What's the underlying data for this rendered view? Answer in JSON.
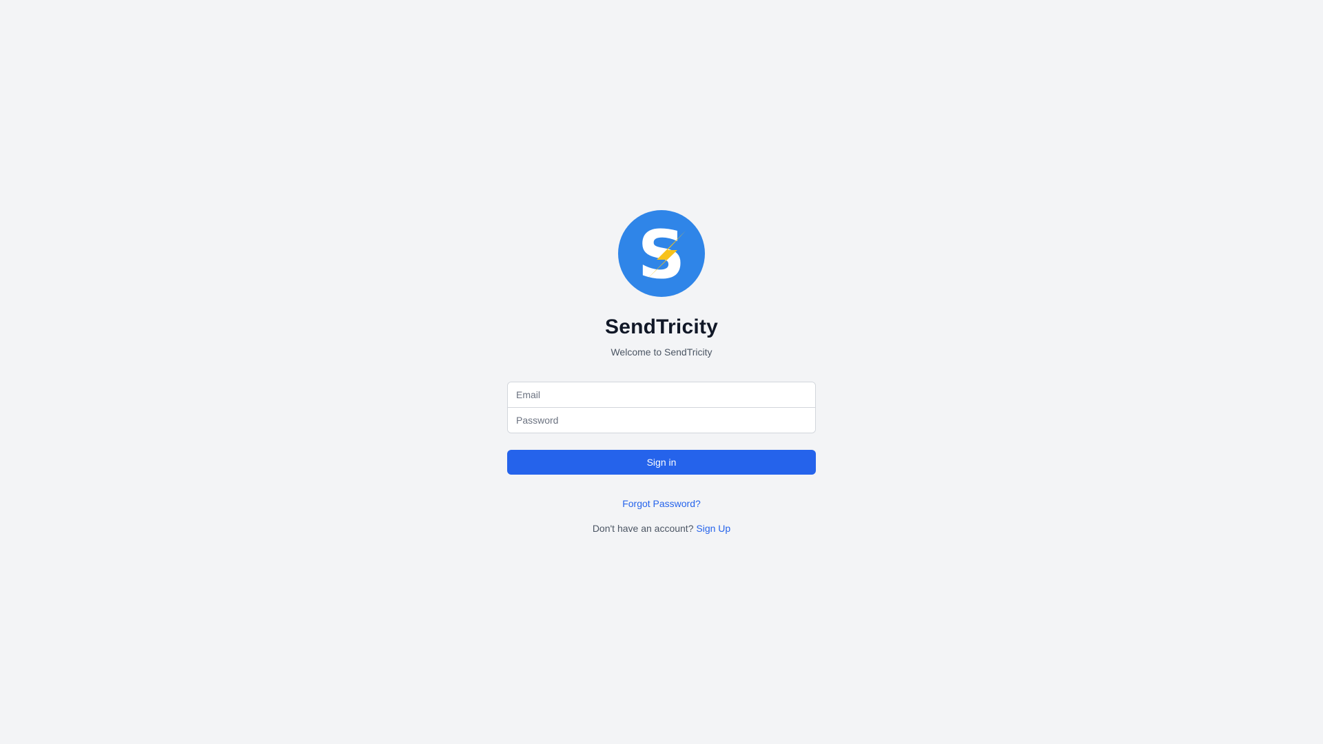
{
  "brand": {
    "title": "SendTricity",
    "subtitle": "Welcome to SendTricity",
    "logo_icon": "lightning-s-logo",
    "colors": {
      "primary": "#2563eb",
      "logo_circle": "#2f85e8",
      "logo_bolt": "#f7c21b",
      "background": "#f3f4f6"
    }
  },
  "form": {
    "email_placeholder": "Email",
    "email_value": "",
    "password_placeholder": "Password",
    "password_value": "",
    "submit_label": "Sign in"
  },
  "links": {
    "forgot_password": "Forgot Password?",
    "signup_prompt": "Don't have an account?",
    "signup_label": "Sign Up"
  }
}
